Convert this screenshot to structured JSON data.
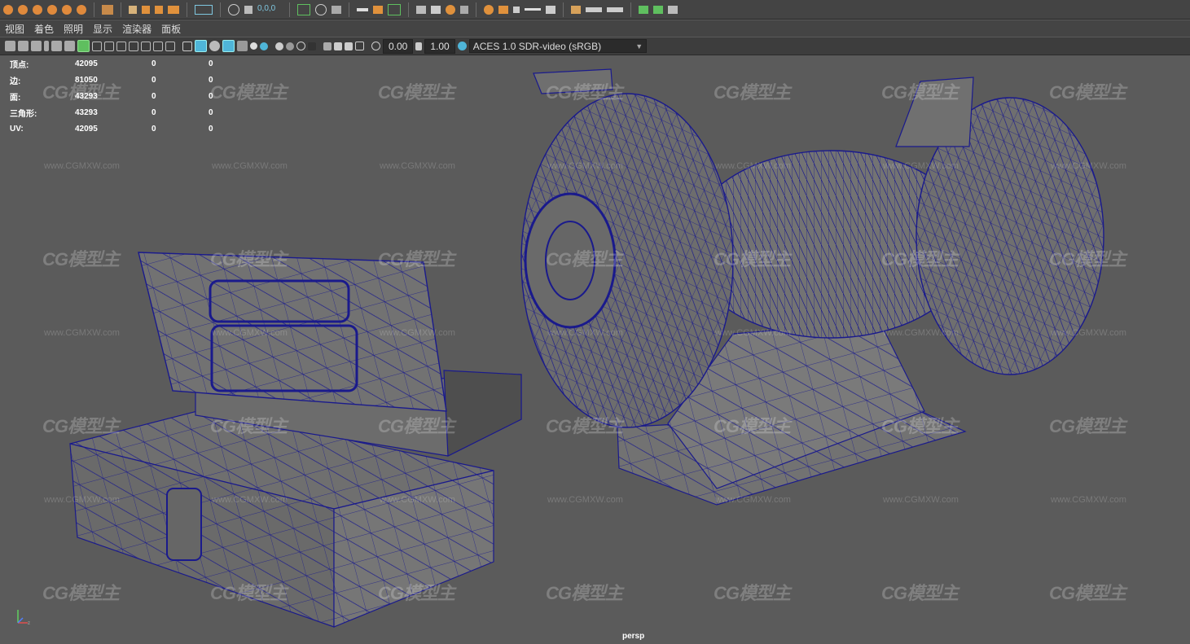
{
  "menu": [
    "视图",
    "着色",
    "照明",
    "显示",
    "渲染器",
    "面板"
  ],
  "viewport_toolbar": {
    "exposure": "0.00",
    "gamma": "1.00",
    "color_space": "ACES 1.0 SDR-video (sRGB)"
  },
  "hud": {
    "rows": [
      {
        "label": "顶点:",
        "value": "42095",
        "a": "0",
        "b": "0"
      },
      {
        "label": "边:",
        "value": "81050",
        "a": "0",
        "b": "0"
      },
      {
        "label": "面:",
        "value": "43293",
        "a": "0",
        "b": "0"
      },
      {
        "label": "三角形:",
        "value": "43293",
        "a": "0",
        "b": "0"
      },
      {
        "label": "UV:",
        "value": "42095",
        "a": "0",
        "b": "0"
      }
    ]
  },
  "watermark": {
    "logo": "CG模型主",
    "url": "www.CGMXW.com"
  },
  "camera": "persp",
  "colors": {
    "wire": "#1a1a8c",
    "viewport_bg": "#5b5b5b",
    "mesh_fill": "#6d6d6d"
  }
}
